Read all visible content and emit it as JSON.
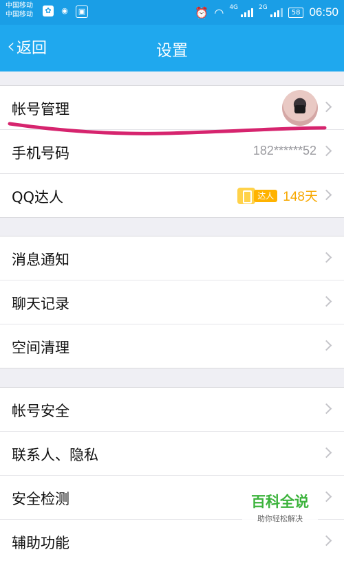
{
  "status_bar": {
    "carrier_1": "中国移动",
    "carrier_2": "中国移动",
    "net_1": "4G",
    "net_2": "2G",
    "battery": "58",
    "time": "06:50"
  },
  "header": {
    "back_label": "返回",
    "title": "设置"
  },
  "groups": [
    {
      "items": [
        {
          "label": "帐号管理"
        },
        {
          "label": "手机号码",
          "value": "182******52"
        },
        {
          "label": "QQ达人",
          "badge": "达人",
          "days": "148天"
        }
      ]
    },
    {
      "items": [
        {
          "label": "消息通知"
        },
        {
          "label": "聊天记录"
        },
        {
          "label": "空间清理"
        }
      ]
    },
    {
      "items": [
        {
          "label": "帐号安全"
        },
        {
          "label": "联系人、隐私"
        },
        {
          "label": "安全检测"
        },
        {
          "label": "辅助功能"
        }
      ]
    }
  ],
  "watermark": {
    "title": "百科全说",
    "subtitle": "助你轻松解决"
  },
  "colors": {
    "header": "#1fa8ee",
    "accent_underline": "#d6246e",
    "days": "#f7a800"
  }
}
